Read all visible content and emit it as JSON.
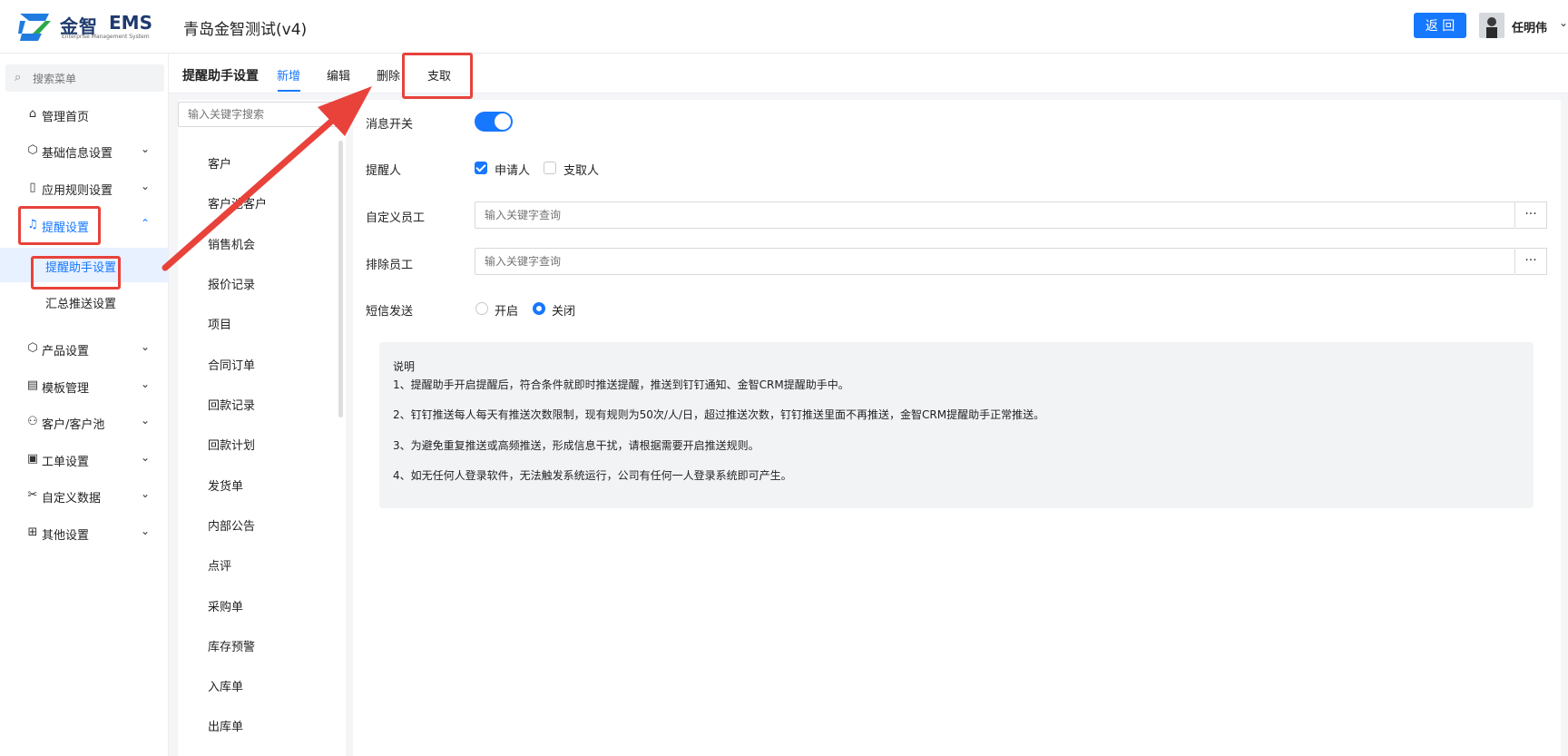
{
  "header": {
    "logo_cn": "金智",
    "logo_en": "EMS",
    "logo_sub": "Enterprise Management System",
    "company": "青岛金智测试(v4)",
    "back_label": "返 回",
    "user_name": "任明伟"
  },
  "sidebar": {
    "search_placeholder": "搜索菜单",
    "items": [
      {
        "label": "管理首页",
        "icon": "home-icon"
      },
      {
        "label": "基础信息设置",
        "icon": "cube-icon"
      },
      {
        "label": "应用规则设置",
        "icon": "document-icon"
      },
      {
        "label": "提醒设置",
        "icon": "bell-icon",
        "active": true
      },
      {
        "label": "产品设置",
        "icon": "cube-icon"
      },
      {
        "label": "模板管理",
        "icon": "template-icon"
      },
      {
        "label": "客户/客户池",
        "icon": "users-icon"
      },
      {
        "label": "工单设置",
        "icon": "ticket-icon"
      },
      {
        "label": "自定义数据",
        "icon": "custom-icon"
      },
      {
        "label": "其他设置",
        "icon": "grid-icon"
      }
    ],
    "sub_items": [
      {
        "label": "提醒助手设置",
        "selected": true
      },
      {
        "label": "汇总推送设置"
      }
    ]
  },
  "content": {
    "title": "提醒助手设置",
    "tabs": [
      "新增",
      "编辑",
      "删除",
      "支取"
    ],
    "active_tab": "新增"
  },
  "list": {
    "search_placeholder": "输入关键字搜索",
    "categories": [
      "客户",
      "客户池客户",
      "销售机会",
      "报价记录",
      "项目",
      "合同订单",
      "回款记录",
      "回款计划",
      "发货单",
      "内部公告",
      "点评",
      "采购单",
      "库存预警",
      "入库单",
      "出库单"
    ]
  },
  "form": {
    "msg_switch_label": "消息开关",
    "msg_switch_on": true,
    "reminder_label": "提醒人",
    "reminder_options": [
      {
        "label": "申请人",
        "checked": true
      },
      {
        "label": "支取人",
        "checked": false
      }
    ],
    "custom_emp_label": "自定义员工",
    "custom_emp_placeholder": "输入关键字查询",
    "exclude_emp_label": "排除员工",
    "exclude_emp_placeholder": "输入关键字查询",
    "more_label": "···",
    "sms_label": "短信发送",
    "sms_options": [
      {
        "label": "开启",
        "checked": false
      },
      {
        "label": "关闭",
        "checked": true
      }
    ]
  },
  "description": {
    "title": "说明",
    "lines": [
      "1、提醒助手开启提醒后，符合条件就即时推送提醒，推送到钉钉通知、金智CRM提醒助手中。",
      "2、钉钉推送每人每天有推送次数限制，现有规则为50次/人/日，超过推送次数，钉钉推送里面不再推送，金智CRM提醒助手正常推送。",
      "3、为避免重复推送或高频推送，形成信息干扰，请根据需要开启推送规则。",
      "4、如无任何人登录软件，无法触发系统运行，公司有任何一人登录系统即可产生。"
    ]
  },
  "colors": {
    "accent": "#1677ff",
    "annotation": "#e8423b"
  }
}
